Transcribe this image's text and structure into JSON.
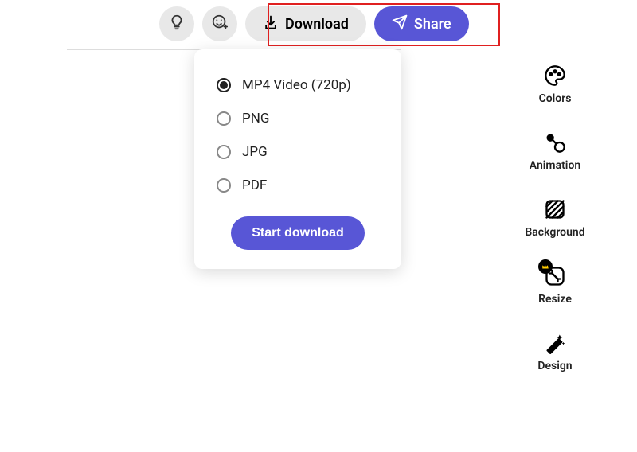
{
  "toolbar": {
    "download_label": "Download",
    "share_label": "Share"
  },
  "dropdown": {
    "options": [
      {
        "label": "MP4 Video (720p)",
        "selected": true
      },
      {
        "label": "PNG",
        "selected": false
      },
      {
        "label": "JPG",
        "selected": false
      },
      {
        "label": "PDF",
        "selected": false
      }
    ],
    "start_label": "Start download"
  },
  "side": {
    "items": [
      {
        "label": "Colors"
      },
      {
        "label": "Animation"
      },
      {
        "label": "Background"
      },
      {
        "label": "Resize"
      },
      {
        "label": "Design"
      }
    ]
  },
  "colors": {
    "accent": "#5856d6",
    "highlight": "#e02020"
  }
}
